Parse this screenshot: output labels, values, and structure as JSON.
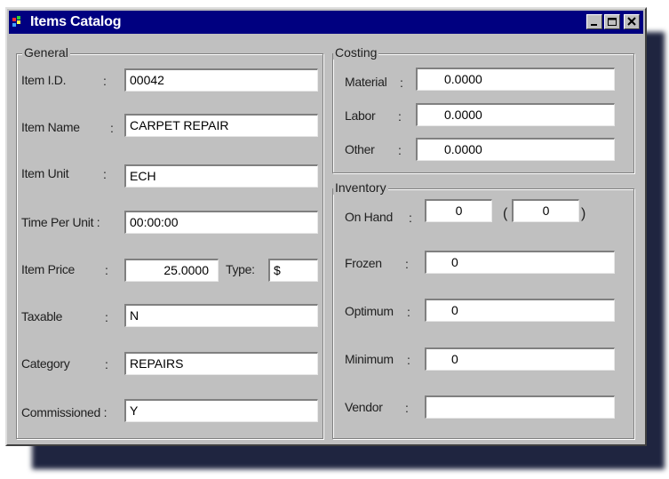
{
  "window": {
    "title": "Items Catalog"
  },
  "general": {
    "label": "General",
    "fields": [
      {
        "label": "Item I.D.",
        "value": "00042"
      },
      {
        "label": "Item Name",
        "value": "CARPET REPAIR"
      },
      {
        "label": "Item Unit",
        "value": "ECH"
      },
      {
        "label": "Time Per Unit :",
        "value": "00:00:00"
      },
      {
        "label": "Item Price",
        "value": "25.0000"
      },
      {
        "label": "Taxable",
        "value": "N"
      },
      {
        "label": "Category",
        "value": "REPAIRS"
      },
      {
        "label": "Commissioned :",
        "value": "Y"
      }
    ],
    "type_label": "Type:",
    "type_value": "$"
  },
  "costing": {
    "label": "Costing",
    "fields": [
      {
        "label": "Material",
        "value": "0.0000"
      },
      {
        "label": "Labor",
        "value": "0.0000"
      },
      {
        "label": "Other",
        "value": "0.0000"
      }
    ]
  },
  "inventory": {
    "label": "Inventory",
    "on_hand": {
      "label": "On Hand",
      "value": "0",
      "paren_value": "0"
    },
    "fields": [
      {
        "label": "Frozen",
        "value": "0"
      },
      {
        "label": "Optimum",
        "value": "0"
      },
      {
        "label": "Minimum",
        "value": "0"
      },
      {
        "label": "Vendor",
        "value": ""
      }
    ]
  },
  "colon": ":",
  "paren_open": "(",
  "paren_close": ")",
  "colors": {
    "titlebar": "#000080",
    "face": "#c0c0c0",
    "shadow": "#1f2540"
  }
}
